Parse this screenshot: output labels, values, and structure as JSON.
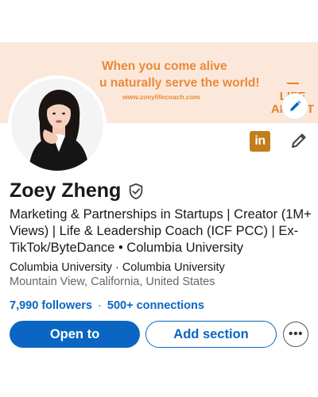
{
  "banner": {
    "line1": "When you come alive",
    "line2": "u naturally serve the world!",
    "url": "www.zoeylifecoach.com",
    "brand_line1": "LIFE",
    "brand_line2": "ARTIST"
  },
  "profile": {
    "name": "Zoey Zheng",
    "headline": "Marketing & Partnerships in Startups | Creator (1M+ Views) | Life & Leadership Coach (ICF PCC) | Ex-TikTok/ByteDance • Columbia University",
    "education": "Columbia University · Columbia University",
    "location": "Mountain View, California, United States",
    "followers": "7,990 followers",
    "separator": "·",
    "connections": "500+ connections"
  },
  "actions": {
    "open_to": "Open to",
    "add_section": "Add section",
    "more": "•••"
  },
  "colors": {
    "accent": "#0a66c2",
    "banner_bg": "#fbe8da",
    "banner_text": "#e98a3a",
    "linkedin_badge": "#c37d1c"
  },
  "icons": {
    "banner_edit": "pencil-icon",
    "profile_edit": "pencil-icon",
    "verified": "shield-check-icon",
    "linkedin": "linkedin-icon",
    "more": "ellipsis-icon"
  }
}
